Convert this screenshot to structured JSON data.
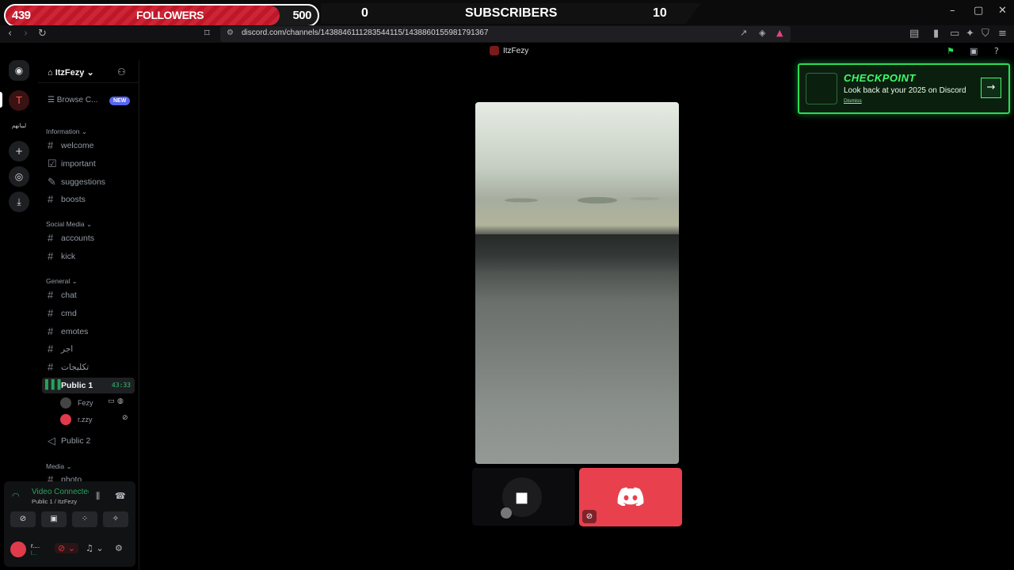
{
  "overlay": {
    "followers_current": "439",
    "followers_label": "FOLLOWERS",
    "followers_goal": "500",
    "followers_progress": 0.878,
    "subs_current": "0",
    "subs_label": "SUBSCRIBERS",
    "subs_goal": "10"
  },
  "browser": {
    "url": "discord.com/channels/1438846111283544115/1438860155981791367",
    "win_min": "–",
    "win_max": "▢",
    "win_close": "✕"
  },
  "window": {
    "title": "ItzFezy"
  },
  "server": {
    "name": "ItzFezy",
    "browse_label": "Browse C...",
    "new_badge": "NEW",
    "rail_label": "لبيانهم"
  },
  "categories": [
    {
      "label": "Information ⌄",
      "channels": [
        "welcome",
        "important",
        "suggestions",
        "boosts"
      ]
    },
    {
      "label": "Social Media ⌄",
      "channels": [
        "accounts",
        "kick"
      ]
    },
    {
      "label": "General ⌄",
      "channels": [
        "chat",
        "cmd",
        "emotes",
        "اجر",
        "تكليجات"
      ]
    }
  ],
  "voice": {
    "active_channel": "Public 1",
    "timer": "43:33",
    "users": [
      "Fezy",
      "r.zzy"
    ],
    "other_channel": "Public 2",
    "media_category": "Media ⌄",
    "media_first": "photo"
  },
  "panel": {
    "status": "Video Connected",
    "location": "Public 1 / ItzFezy",
    "user_name": "r....",
    "user_status": "l..."
  },
  "checkpoint": {
    "title": "CHECKPOINT",
    "subtitle": "Look back at your 2025 on Discord",
    "dismiss": "Dismiss"
  },
  "colors": {
    "accent_green": "#2bdc55",
    "voice_green": "#23a55a",
    "brand": "#5865f2",
    "user_tile": "#e8404d",
    "overlay_red": "#c9182a"
  }
}
